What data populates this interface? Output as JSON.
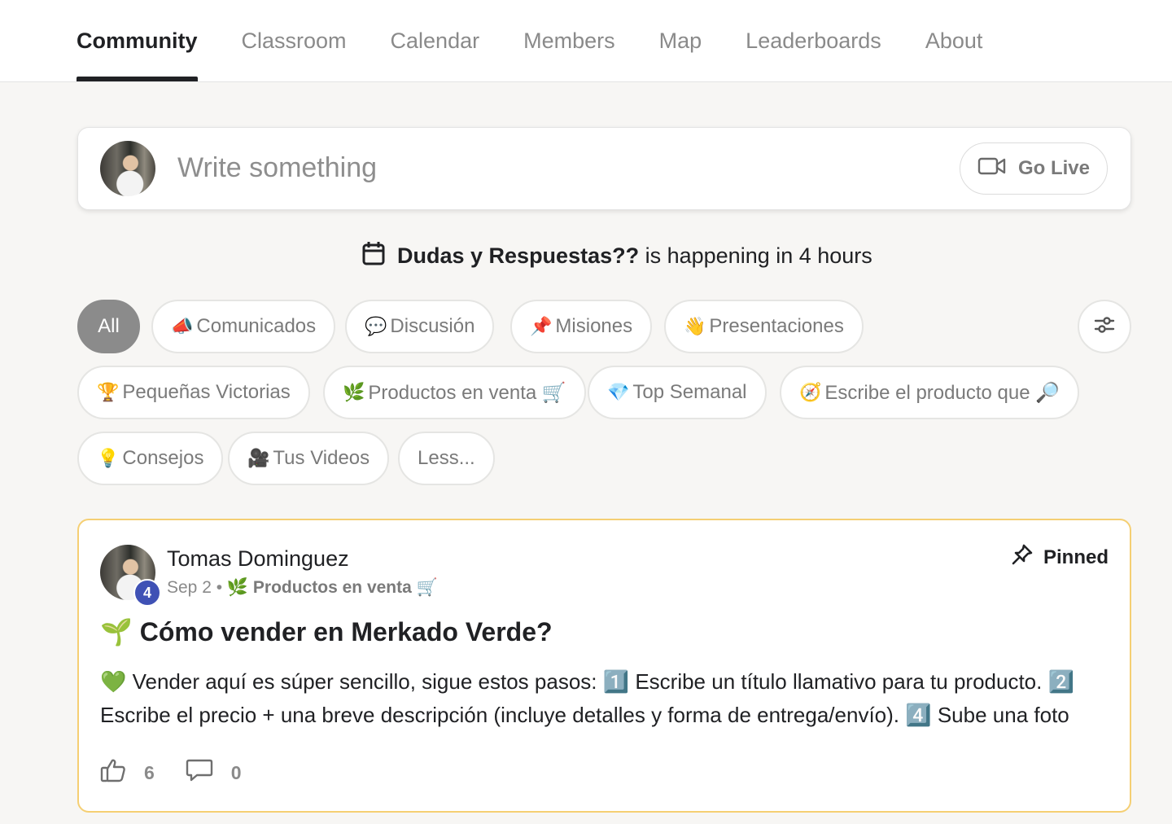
{
  "nav": {
    "tabs": [
      {
        "label": "Community",
        "active": true
      },
      {
        "label": "Classroom"
      },
      {
        "label": "Calendar"
      },
      {
        "label": "Members"
      },
      {
        "label": "Map"
      },
      {
        "label": "Leaderboards"
      },
      {
        "label": "About"
      }
    ]
  },
  "composer": {
    "placeholder": "Write something",
    "go_live_label": "Go Live"
  },
  "event": {
    "name": "Dudas y Respuestas??",
    "suffix": " is happening in 4 hours"
  },
  "categories": {
    "all_label": "All",
    "items": [
      {
        "emoji": "📣",
        "label": "Comunicados"
      },
      {
        "emoji": "💬",
        "label": "Discusión"
      },
      {
        "emoji": "📌",
        "label": "Misiones"
      },
      {
        "emoji": "👋",
        "label": "Presentaciones"
      },
      {
        "emoji": "🏆",
        "label": "Pequeñas Victorias"
      },
      {
        "emoji": "🌿",
        "label": "Productos en venta 🛒"
      },
      {
        "emoji": "💎",
        "label": "Top Semanal"
      },
      {
        "emoji": "🧭",
        "label": "Escribe el producto que 🔎"
      },
      {
        "emoji": "💡",
        "label": "Consejos"
      },
      {
        "emoji": "🎥",
        "label": "Tus Videos"
      }
    ],
    "less_label": "Less..."
  },
  "post": {
    "author": "Tomas Dominguez",
    "level": "4",
    "date": "Sep 2",
    "separator": " • ",
    "category_emoji": "🌿",
    "category": "Productos en venta 🛒",
    "pinned_label": "Pinned",
    "title_emoji": "🌱",
    "title": "Cómo vender en Merkado Verde?",
    "body": "💚 Vender aquí es súper sencillo, sigue estos pasos: 1️⃣ Escribe un título llamativo para tu producto. 2️⃣ Escribe el precio + una breve descripción (incluye detalles y forma de entrega/envío). 4️⃣ Sube una foto",
    "likes": "6",
    "comments": "0"
  },
  "colors": {
    "accent_pinned_border": "#f5cf73",
    "chip_active_bg": "#8b8b8b",
    "level_badge": "#3f51b5"
  }
}
